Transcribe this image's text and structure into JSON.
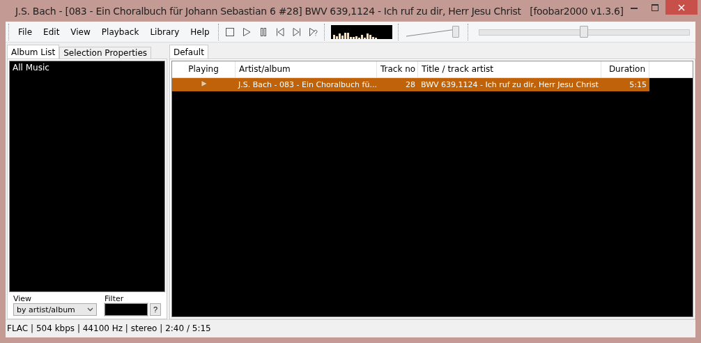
{
  "window": {
    "title": "J.S. Bach - [083 - Ein Choralbuch für Johann Sebastian 6 #28] BWV 639,1124 - Ich ruf zu dir, Herr Jesu Christ   [foobar2000 v1.3.6]"
  },
  "menu": [
    "File",
    "Edit",
    "View",
    "Playback",
    "Library",
    "Help"
  ],
  "transport": [
    {
      "kind": "stop"
    },
    {
      "kind": "play"
    },
    {
      "kind": "pause"
    },
    {
      "kind": "previous"
    },
    {
      "kind": "next"
    },
    {
      "kind": "random"
    }
  ],
  "volume": {
    "level": 1.0
  },
  "seek": {
    "level": 0.5
  },
  "left_panel": {
    "tabs": [
      {
        "label": "Album List",
        "selected": true
      },
      {
        "label": "Selection Properties",
        "selected": false
      }
    ],
    "tree": [
      "All Music"
    ],
    "view_label": "View",
    "view_value": "by artist/album",
    "filter_label": "Filter",
    "help_button": "?"
  },
  "playlist": {
    "tabs": [
      {
        "label": "Default",
        "selected": true
      }
    ],
    "columns": [
      "Playing",
      "Artist/album",
      "Track no",
      "Title / track artist",
      "Duration"
    ],
    "rows": [
      {
        "playing": true,
        "selected": true,
        "artist_album": "J.S. Bach - 083 - Ein Choralbuch fü...",
        "track_no": "28",
        "title": "BWV 639,1124 - Ich ruf zu dir, Herr Jesu Christ",
        "duration": "5:15"
      }
    ]
  },
  "status_bar": "FLAC | 504 kbps | 44100 Hz | stereo | 2:40 / 5:15"
}
